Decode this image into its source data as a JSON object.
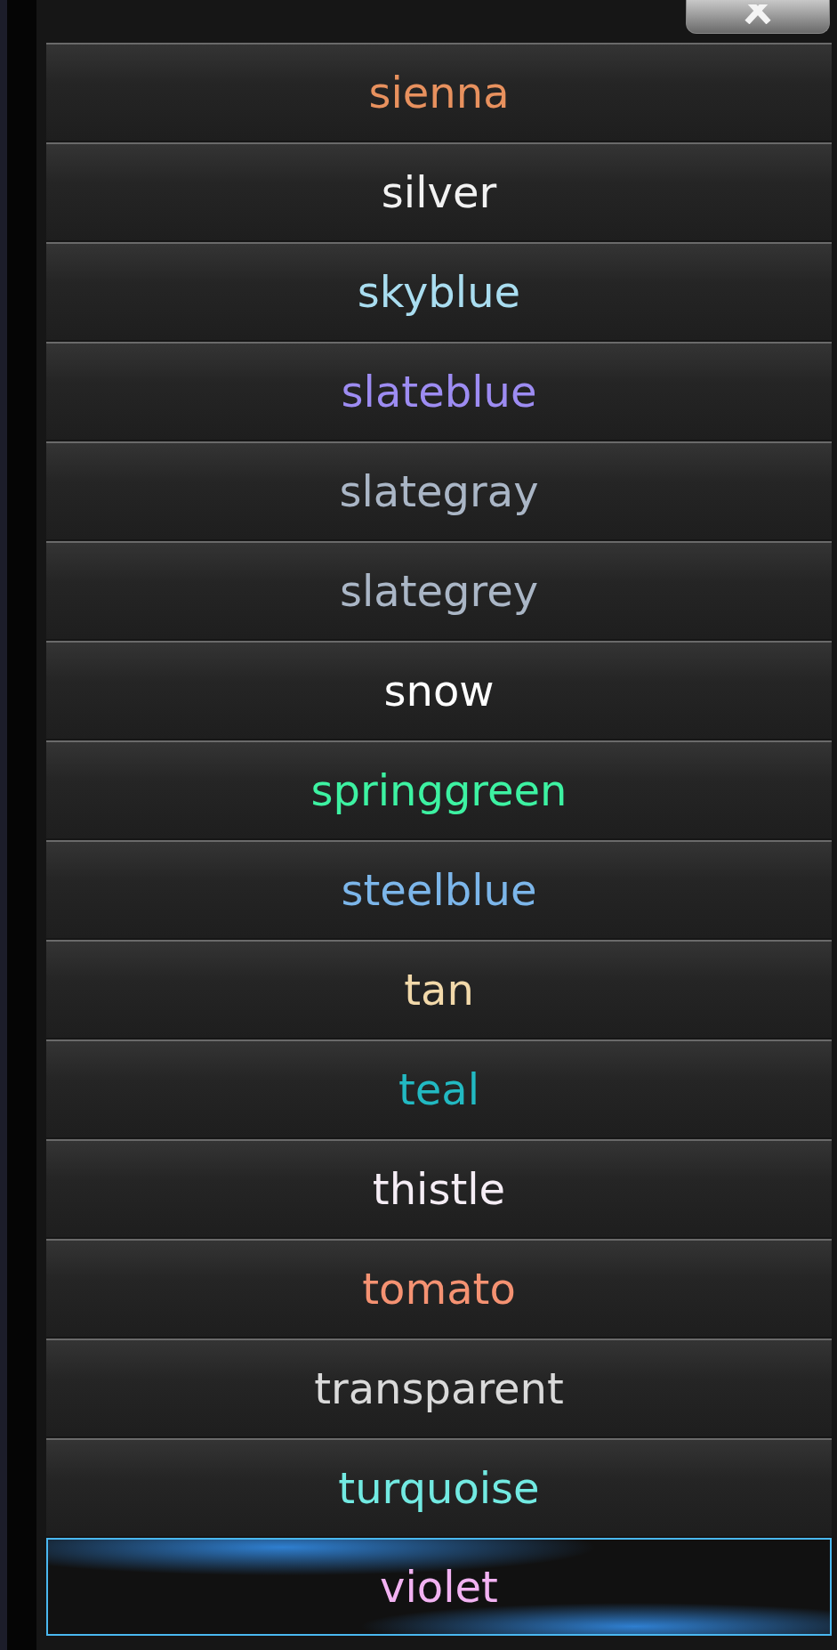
{
  "items": [
    {
      "label": "sienna",
      "color": "#e8915e",
      "selected": false
    },
    {
      "label": "silver",
      "color": "#f2f2f2",
      "selected": false
    },
    {
      "label": "skyblue",
      "color": "#a9ddf0",
      "selected": false
    },
    {
      "label": "slateblue",
      "color": "#9d8cf2",
      "selected": false
    },
    {
      "label": "slategray",
      "color": "#aab6c6",
      "selected": false
    },
    {
      "label": "slategrey",
      "color": "#aab6c6",
      "selected": false
    },
    {
      "label": "snow",
      "color": "#ffffff",
      "selected": false
    },
    {
      "label": "springgreen",
      "color": "#3df2a2",
      "selected": false
    },
    {
      "label": "steelblue",
      "color": "#7cb6ea",
      "selected": false
    },
    {
      "label": "tan",
      "color": "#f2d9aa",
      "selected": false
    },
    {
      "label": "teal",
      "color": "#22b9c2",
      "selected": false
    },
    {
      "label": "thistle",
      "color": "#f5edf5",
      "selected": false
    },
    {
      "label": "tomato",
      "color": "#f59272",
      "selected": false
    },
    {
      "label": "transparent",
      "color": "#dadada",
      "selected": false
    },
    {
      "label": "turquoise",
      "color": "#72eae2",
      "selected": false
    },
    {
      "label": "violet",
      "color": "#f2b2f2",
      "selected": true
    }
  ]
}
